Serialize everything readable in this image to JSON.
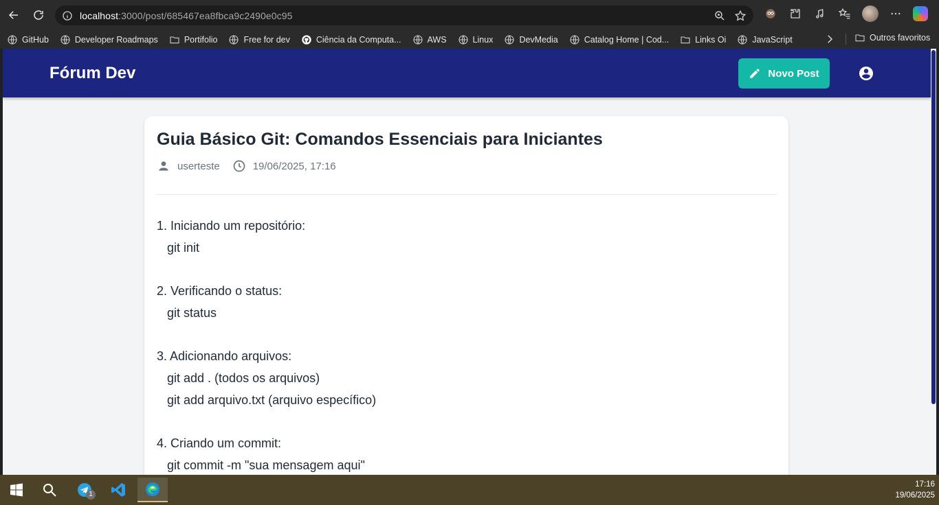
{
  "browser": {
    "url_host": "localhost",
    "url_path": ":3000/post/685467ea8fbca9c2490e0c95",
    "bookmarks": [
      {
        "label": "GitHub",
        "icon": "globe-icon"
      },
      {
        "label": "Developer Roadmaps",
        "icon": "globe-icon"
      },
      {
        "label": "Portifolio",
        "icon": "folder-icon"
      },
      {
        "label": "Free for dev",
        "icon": "globe-icon"
      },
      {
        "label": "Ciência da Computa...",
        "icon": "github-icon"
      },
      {
        "label": "AWS",
        "icon": "globe-icon"
      },
      {
        "label": "Linux",
        "icon": "globe-icon"
      },
      {
        "label": "DevMedia",
        "icon": "globe-icon"
      },
      {
        "label": "Catalog Home | Cod...",
        "icon": "globe-icon"
      },
      {
        "label": "Links Oi",
        "icon": "folder-icon"
      },
      {
        "label": "JavaScript",
        "icon": "globe-icon"
      }
    ],
    "other_favorites": "Outros favoritos"
  },
  "app": {
    "brand": "Fórum Dev",
    "new_post_label": "Novo Post",
    "accent_color": "#1c2580",
    "button_color": "#15b8a6"
  },
  "post": {
    "title": "Guia Básico Git: Comandos Essenciais para Iniciantes",
    "author": "userteste",
    "date": "19/06/2025, 17:16",
    "content": "1. Iniciando um repositório:\n   git init\n\n2. Verificando o status:\n   git status\n\n3. Adicionando arquivos:\n   git add . (todos os arquivos)\n   git add arquivo.txt (arquivo específico)\n\n4. Criando um commit:\n   git commit -m \"sua mensagem aqui\""
  },
  "taskbar": {
    "time": "17:16",
    "date": "19/06/2025",
    "telegram_badge": "1"
  }
}
